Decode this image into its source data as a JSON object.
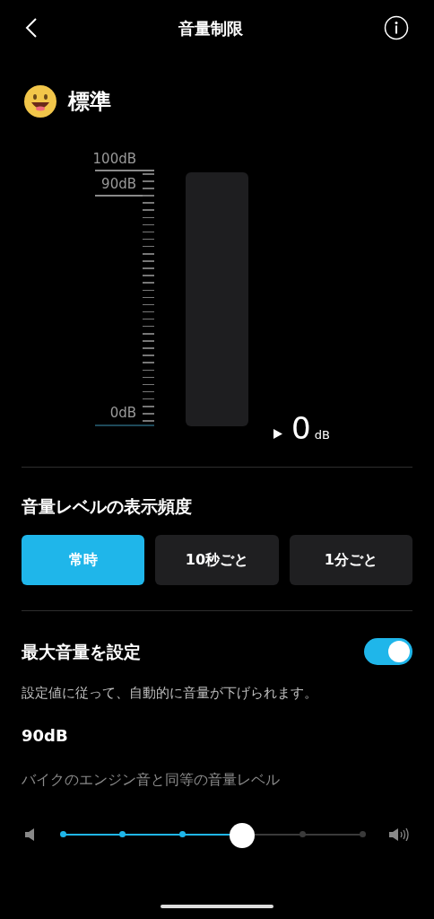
{
  "header": {
    "title": "音量制限"
  },
  "mode": {
    "label": "標準"
  },
  "meter": {
    "scale_labels": [
      "100dB",
      "90dB",
      "0dB"
    ],
    "level": 0,
    "reading": "0",
    "unit": "dB"
  },
  "frequency": {
    "heading": "音量レベルの表示頻度",
    "options": [
      {
        "label": "常時",
        "selected": true
      },
      {
        "label": "10秒ごと",
        "selected": false
      },
      {
        "label": "1分ごと",
        "selected": false
      }
    ]
  },
  "max_volume": {
    "label": "最大音量を設定",
    "on": true,
    "description": "設定値に従って、自動的に音量が下げられます。",
    "value": "90dB",
    "note": "バイクのエンジン音と同等の音量レベル",
    "level": 0.6
  }
}
